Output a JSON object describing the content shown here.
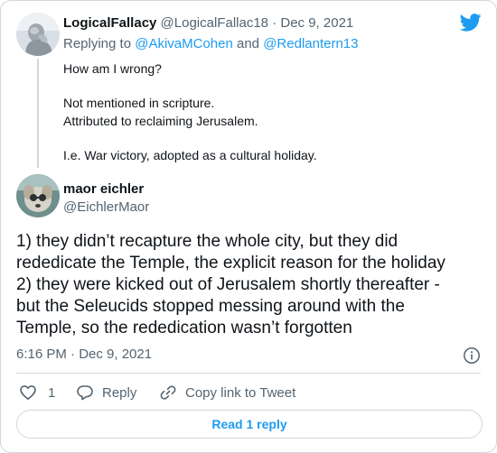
{
  "parent_tweet": {
    "display_name": "LogicalFallacy",
    "handle": "@LogicalFallac18",
    "separator": " · ",
    "date": "Dec 9, 2021",
    "replying_to_prefix": "Replying to ",
    "mentions": [
      "@AkivaMCohen",
      "@Redlantern13"
    ],
    "mention_joiner": " and ",
    "lines": [
      "How am I wrong?",
      "",
      "Not mentioned in scripture.",
      "Attributed to reclaiming Jerusalem.",
      "",
      "I.e. War victory, adopted as a cultural holiday."
    ]
  },
  "main_tweet": {
    "display_name": "maor eichler",
    "handle": "@EichlerMaor",
    "lines": [
      "1) they didn’t recapture the whole city, but they did",
      "rededicate the Temple, the explicit reason for the holiday",
      "2) they were kicked out of Jerusalem shortly thereafter -",
      "but the Seleucids stopped messing around with the",
      "Temple, so the rededication wasn’t forgotten"
    ],
    "timestamp": "6:16 PM · Dec 9, 2021"
  },
  "actions": {
    "like_count": "1",
    "reply_label": "Reply",
    "copy_link_label": "Copy link to Tweet"
  },
  "read_replies_label": "Read 1 reply",
  "icons": {
    "brand": "twitter-bird-icon",
    "info": "info-icon",
    "like": "heart-icon",
    "reply": "speech-bubble-icon",
    "copy": "link-icon"
  },
  "colors": {
    "accent": "#1d9bf0",
    "text": "#0f1419",
    "secondary": "#536471",
    "border": "#cfd9de"
  }
}
